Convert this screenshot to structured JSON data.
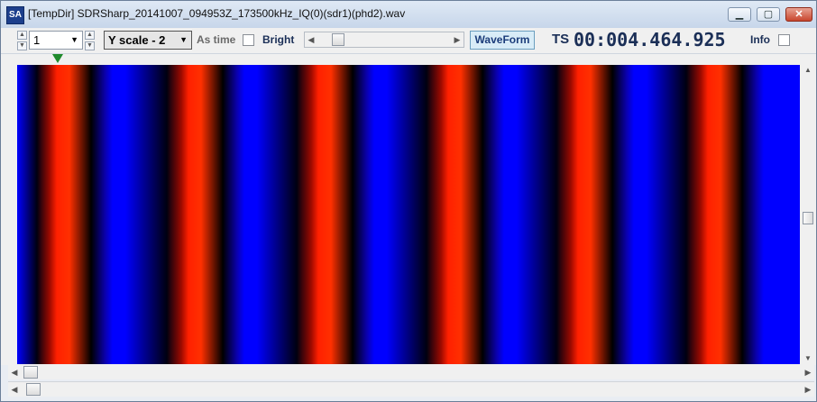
{
  "window": {
    "title": "[TempDir] SDRSharp_20141007_094953Z_173500kHz_IQ(0)(sdr1)(phd2).wav",
    "app_icon_text": "SA"
  },
  "toolbar": {
    "channel_value": "1",
    "yscale_value": "Y scale - 2",
    "as_time_label": "As time",
    "bright_label": "Bright",
    "waveform_label": "WaveForm",
    "ts_label": "TS",
    "ts_value": "00:004.464.925",
    "info_label": "Info"
  },
  "plot": {
    "colors": {
      "blue": "#0000ff",
      "red": "#ff2000",
      "marker": "#1f8a2c"
    }
  }
}
